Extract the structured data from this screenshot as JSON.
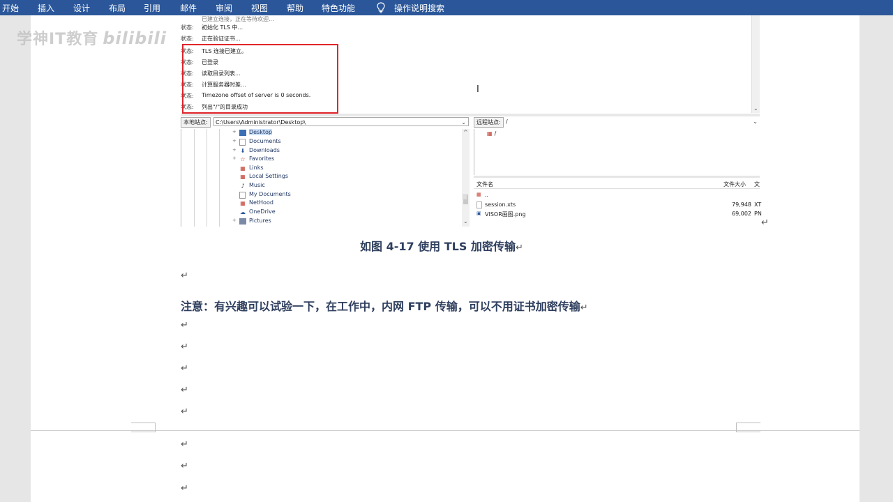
{
  "ribbon": {
    "tabs": [
      "开始",
      "插入",
      "设计",
      "布局",
      "引用",
      "邮件",
      "审阅",
      "视图",
      "帮助",
      "特色功能"
    ],
    "search_label": "操作说明搜索",
    "search_icon": "lightbulb-icon",
    "color": "#2b579a"
  },
  "watermark": {
    "text": "学神IT教育",
    "logo": "bilibili"
  },
  "screenshot": {
    "log_partial_top": "已建立连接，正在等待欢迎...",
    "log": [
      {
        "key": "状态:",
        "value": "初始化 TLS 中..."
      },
      {
        "key": "状态:",
        "value": "正在验证证书..."
      },
      {
        "key": "状态:",
        "value": "TLS 连接已建立。"
      },
      {
        "key": "状态:",
        "value": "已登录"
      },
      {
        "key": "状态:",
        "value": "读取目录列表..."
      },
      {
        "key": "状态:",
        "value": "计算服务器时差..."
      },
      {
        "key": "状态:",
        "value": "Timezone offset of server is 0 seconds."
      },
      {
        "key": "状态:",
        "value": "列出\"/\"的目录成功"
      }
    ],
    "highlight_color": "#e0242c",
    "local": {
      "label": "本地站点:",
      "path": "C:\\Users\\Administrator\\Desktop\\",
      "tree": [
        {
          "name": "Desktop",
          "icon": "folder-icon",
          "selected": true
        },
        {
          "name": "Documents",
          "icon": "folder-icon",
          "selected": false
        },
        {
          "name": "Downloads",
          "icon": "download-icon",
          "selected": false
        },
        {
          "name": "Favorites",
          "icon": "star-icon",
          "selected": false
        },
        {
          "name": "Links",
          "icon": "folder-icon",
          "selected": false
        },
        {
          "name": "Local Settings",
          "icon": "folder-icon",
          "selected": false
        },
        {
          "name": "Music",
          "icon": "music-icon",
          "selected": false
        },
        {
          "name": "My Documents",
          "icon": "folder-icon",
          "selected": false
        },
        {
          "name": "NetHood",
          "icon": "folder-icon",
          "selected": false
        },
        {
          "name": "OneDrive",
          "icon": "cloud-icon",
          "selected": false
        },
        {
          "name": "Pictures",
          "icon": "pictures-icon",
          "selected": false
        }
      ]
    },
    "remote": {
      "label": "远程站点:",
      "path": "/",
      "root": "/",
      "columns": [
        "文件名",
        "文件大小",
        "文"
      ],
      "files": [
        {
          "name": "..",
          "size": "",
          "type": ""
        },
        {
          "name": "session.xts",
          "size": "79,948",
          "type": "XT"
        },
        {
          "name": "VISOR画图.png",
          "size": "69,002",
          "type": "PN"
        }
      ]
    }
  },
  "document": {
    "caption": "如图  4-17  使用 TLS 加密传输",
    "note": "注意：有兴趣可以试验一下，在工作中，内网 FTP 传输，可以不用证书加密传输",
    "return_mark": "↵"
  }
}
